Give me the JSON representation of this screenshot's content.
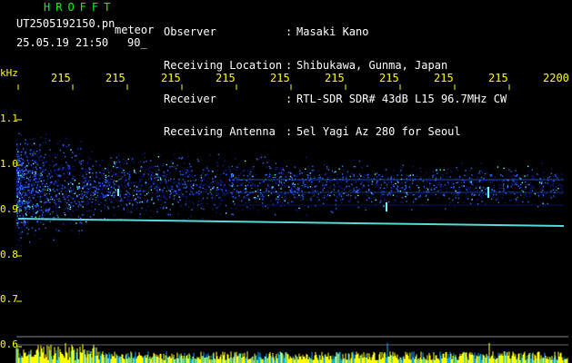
{
  "app": {
    "title": "HROFFT",
    "filename": "UT2505192150.pn",
    "mode": "meteor",
    "datetime": "25.05.19 21:50",
    "count": "90_"
  },
  "header": {
    "labels": [
      "Observer",
      "Receiving Location",
      "Receiver",
      "Receiving Antenna"
    ],
    "colons": [
      ":",
      ":",
      ":",
      ":"
    ],
    "values": [
      "Masaki Kano",
      "Shibukawa, Gunma, Japan",
      "RTL-SDR SDR# 43dB L15 96.7MHz CW",
      "5el Yagi Az 280 for Seoul"
    ]
  },
  "axes": {
    "y_unit": "kHz",
    "x_ticks": [
      "215",
      "215",
      "215",
      "215",
      "215",
      "215",
      "215",
      "215",
      "215",
      "2200"
    ],
    "y_ticks": [
      "1.1",
      "1.0",
      "0.9",
      "0.8",
      "0.7",
      "0.6"
    ]
  },
  "colors": {
    "background": "#000000",
    "title": "#00ff00",
    "ticks": "#ffff00",
    "header_text": "#ffffff",
    "signal_low": "#0a1a8c",
    "signal_mid": "#2a6cff",
    "signal_high": "#66ffff",
    "activity_bar": "#ffff00",
    "activity_base": "#00aaff"
  }
}
